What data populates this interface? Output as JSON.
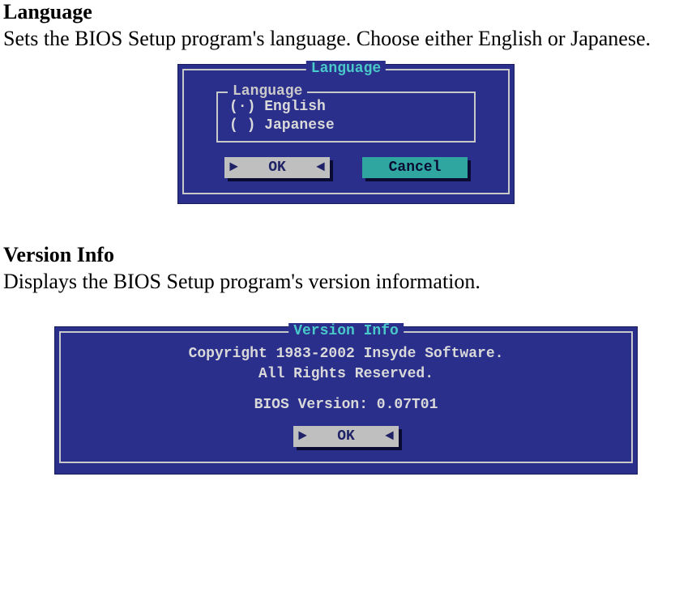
{
  "sections": {
    "language": {
      "heading": "Language",
      "description": "Sets the BIOS Setup program's language. Choose either English or Japanese."
    },
    "version": {
      "heading": "Version Info",
      "description": "Displays the BIOS Setup program's version information."
    }
  },
  "language_dialog": {
    "outer_title": "Language",
    "inner_title": "Language",
    "options": [
      {
        "label": "English",
        "selected": true
      },
      {
        "label": "Japanese",
        "selected": false
      }
    ],
    "option_english_row": "(·) English",
    "option_japanese_row": "( ) Japanese",
    "buttons": {
      "ok": "OK",
      "cancel": "Cancel"
    }
  },
  "version_dialog": {
    "title": "Version Info",
    "copyright_line": "Copyright 1983-2002 Insyde Software.",
    "rights_line": "All Rights Reserved.",
    "bios_version_label": "BIOS Version:",
    "bios_version_value": "0.07T01",
    "bios_version_line": "BIOS Version: 0.07T01",
    "buttons": {
      "ok": "OK"
    }
  }
}
